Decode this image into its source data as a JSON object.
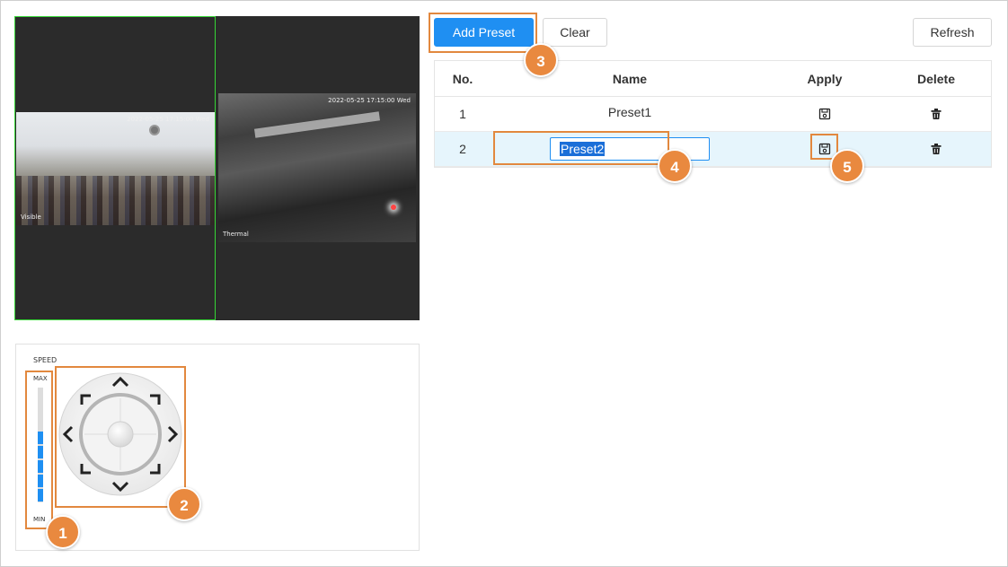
{
  "toolbar": {
    "add_preset_label": "Add Preset",
    "clear_label": "Clear",
    "refresh_label": "Refresh"
  },
  "table": {
    "headers": {
      "no": "No.",
      "name": "Name",
      "apply": "Apply",
      "delete": "Delete"
    },
    "rows": [
      {
        "no": "1",
        "name": "Preset1",
        "apply_icon": "save-icon",
        "delete_icon": "trash-icon",
        "selected": false
      },
      {
        "no": "2",
        "name": "Preset2",
        "apply_icon": "save-icon",
        "delete_icon": "trash-icon",
        "selected": true,
        "editing": true
      }
    ]
  },
  "ptz": {
    "speed_title": "SPEED",
    "speed_max": "MAX",
    "speed_min": "MIN",
    "speed_level": 5,
    "speed_max_level": 8,
    "directions": [
      "up-icon",
      "down-icon",
      "left-icon",
      "right-icon",
      "up-left-icon",
      "up-right-icon",
      "down-left-icon",
      "down-right-icon"
    ]
  },
  "video": {
    "visible_timestamp": "2022-05-25 17:15:00 Wed",
    "visible_tag": "Visible",
    "thermal_timestamp": "2022-05-25 17:15:00 Wed",
    "thermal_tag": "Thermal"
  },
  "callouts": [
    "1",
    "2",
    "3",
    "4",
    "5"
  ],
  "colors": {
    "accent": "#1f8ff2",
    "callout": "#e9893f",
    "selected_row": "#e6f5fc",
    "active_pane_border": "#36d636"
  }
}
